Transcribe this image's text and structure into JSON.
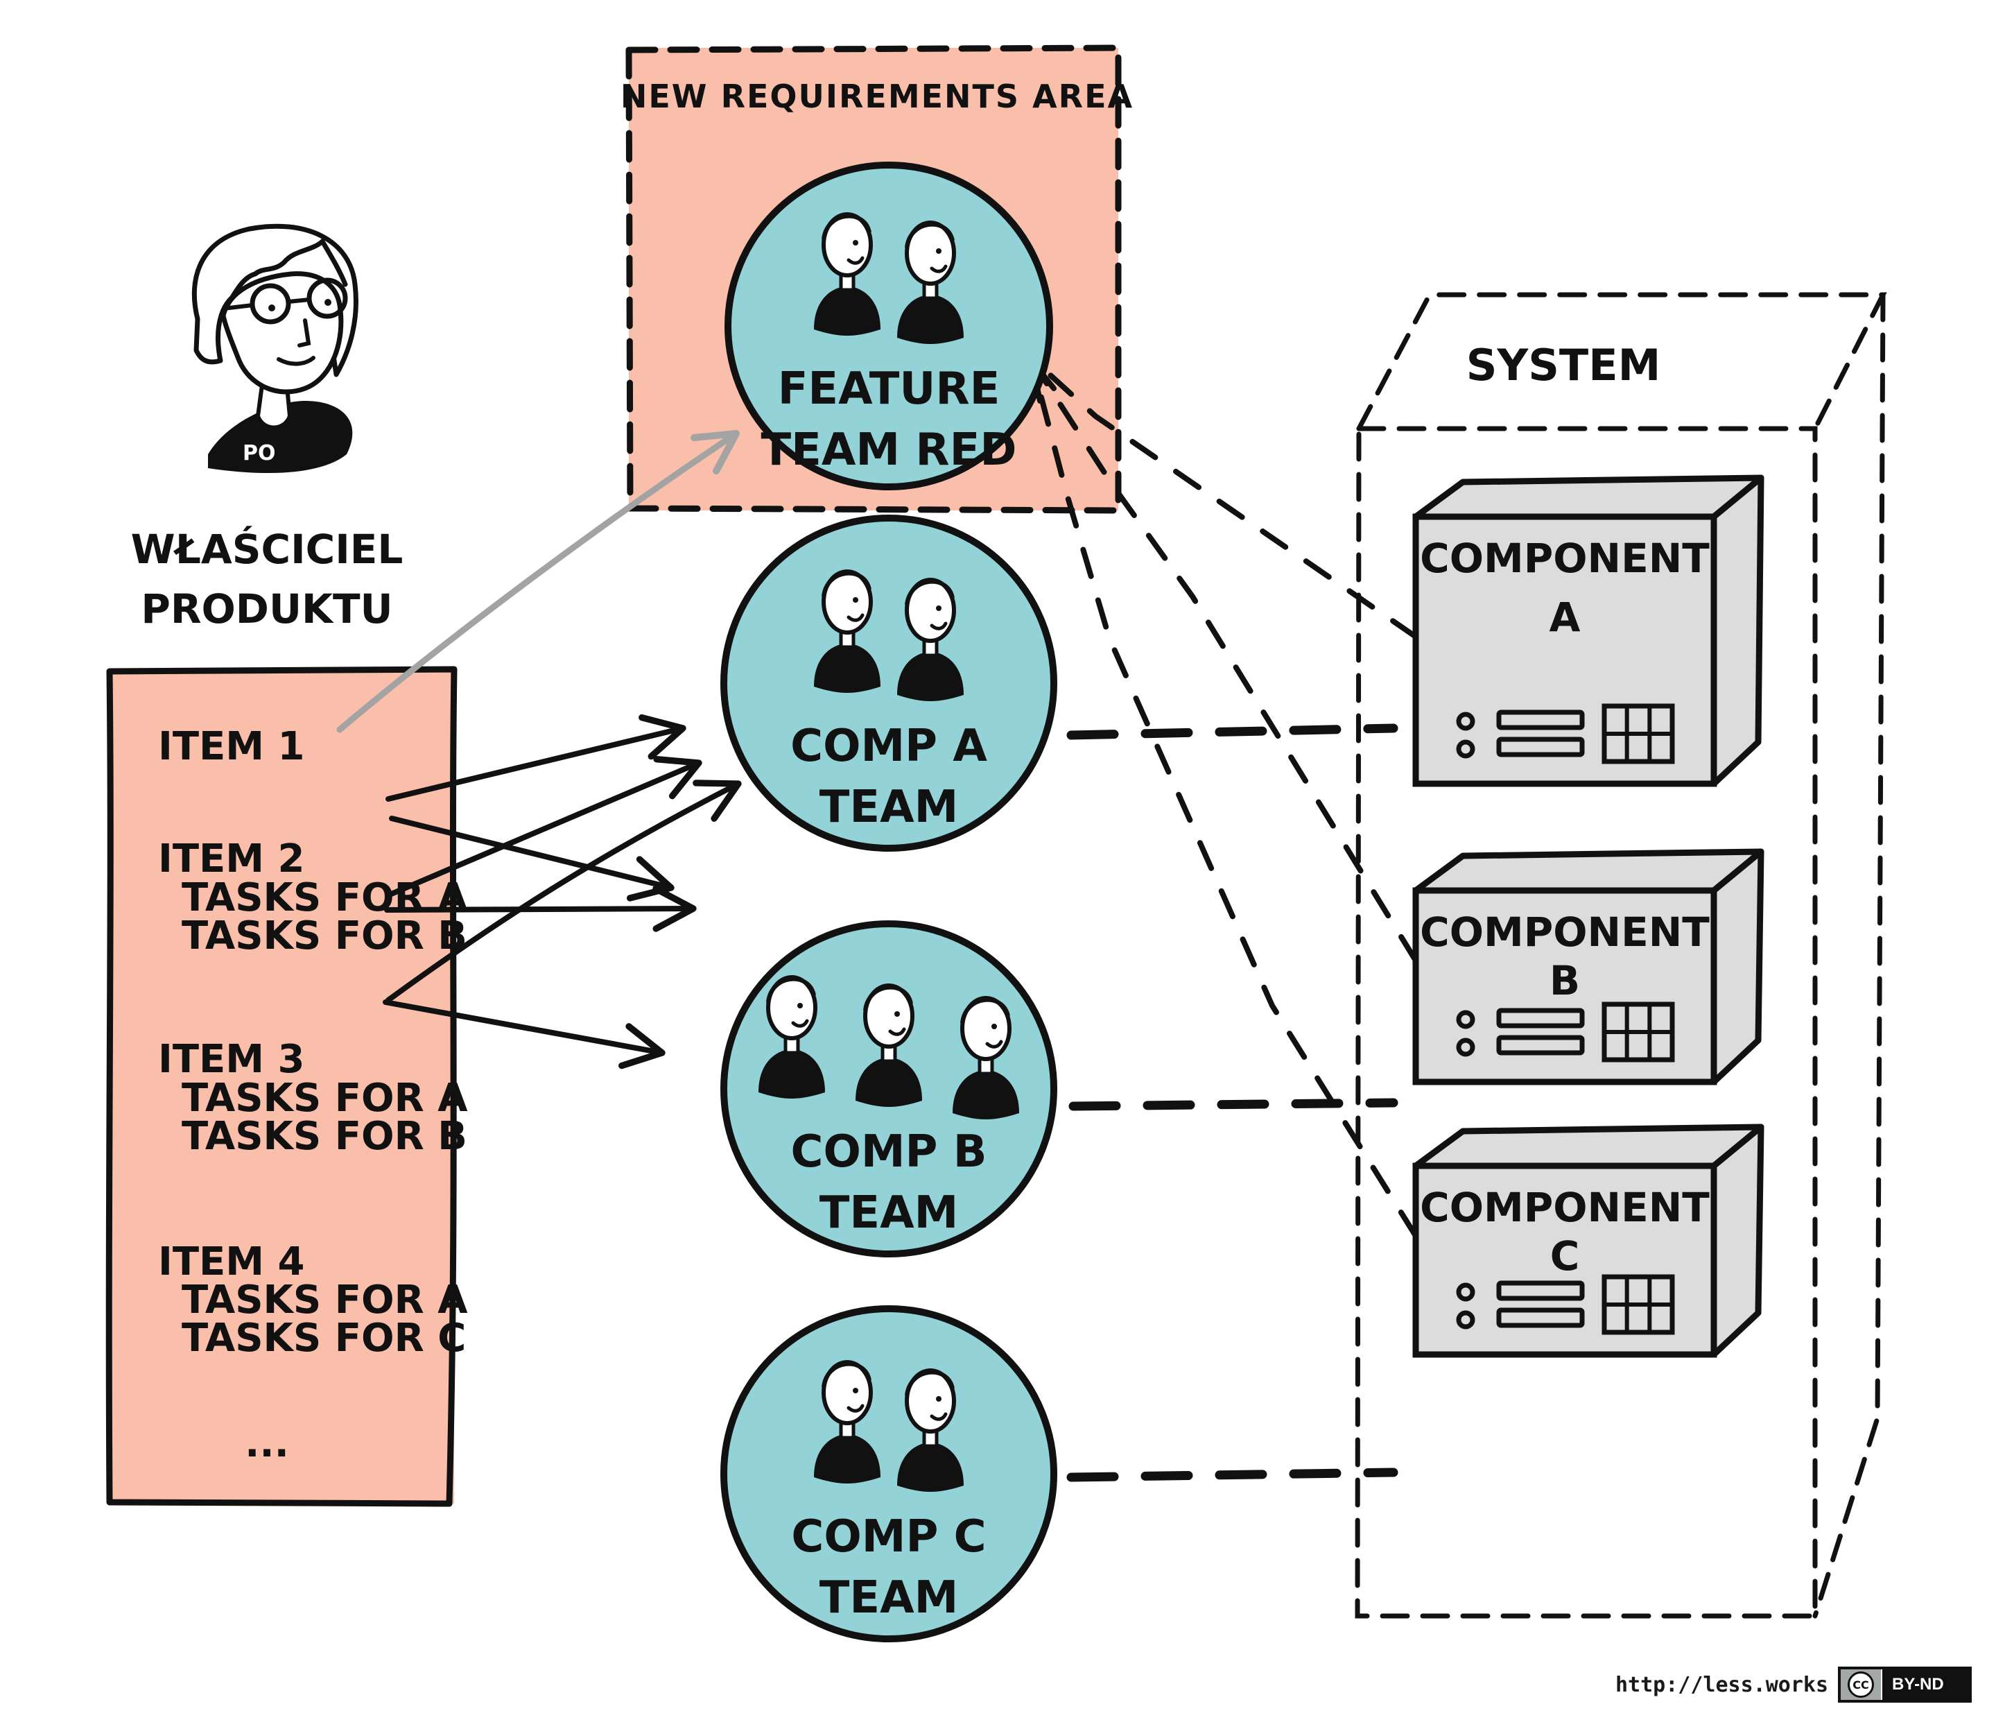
{
  "colors": {
    "backlog_fill": "#f9bfab",
    "team_fill": "#93d3d8",
    "component_fill": "#dcdcdc",
    "ink": "#111111",
    "gray_arrow": "#a3a3a3"
  },
  "product_owner": {
    "badge": "PO",
    "label_line1": "WŁAŚCICIEL",
    "label_line2": "PRODUKTU"
  },
  "backlog": {
    "items": [
      {
        "title": "ITEM 1",
        "tasks": []
      },
      {
        "title": "ITEM 2",
        "tasks": [
          "TASKS FOR A",
          "TASKS FOR B"
        ]
      },
      {
        "title": "ITEM 3",
        "tasks": [
          "TASKS FOR A",
          "TASKS FOR B"
        ]
      },
      {
        "title": "ITEM 4",
        "tasks": [
          "TASKS FOR A",
          "TASKS FOR C"
        ]
      }
    ],
    "ellipsis": "..."
  },
  "requirements_area": {
    "title": "NEW REQUIREMENTS AREA"
  },
  "teams": [
    {
      "id": "feature-red",
      "line1": "FEATURE",
      "line2": "TEAM RED",
      "members": 2
    },
    {
      "id": "comp-a",
      "line1": "COMP A",
      "line2": "TEAM",
      "members": 2
    },
    {
      "id": "comp-b",
      "line1": "COMP B",
      "line2": "TEAM",
      "members": 3
    },
    {
      "id": "comp-c",
      "line1": "COMP C",
      "line2": "TEAM",
      "members": 2
    }
  ],
  "system": {
    "title": "SYSTEM",
    "components": [
      {
        "line1": "COMPONENT",
        "line2": "A"
      },
      {
        "line1": "COMPONENT",
        "line2": "B"
      },
      {
        "line1": "COMPONENT",
        "line2": "C"
      }
    ]
  },
  "connections": {
    "item_arrows": [
      {
        "from": "ITEM 1",
        "to": "FEATURE TEAM RED",
        "style": "gray"
      },
      {
        "from": "ITEM 2 / TASKS FOR A",
        "to": "COMP A TEAM",
        "style": "solid"
      },
      {
        "from": "ITEM 2 / TASKS FOR B",
        "to": "COMP B TEAM",
        "style": "solid"
      },
      {
        "from": "ITEM 3 / TASKS FOR A",
        "to": "COMP A TEAM",
        "style": "solid"
      },
      {
        "from": "ITEM 3 / TASKS FOR B",
        "to": "COMP B TEAM",
        "style": "solid"
      },
      {
        "from": "ITEM 4 / TASKS FOR A",
        "to": "COMP A TEAM",
        "style": "solid"
      },
      {
        "from": "ITEM 4 / TASKS FOR C",
        "to": "COMP C TEAM",
        "style": "solid"
      }
    ],
    "component_links": [
      {
        "from": "COMP A TEAM",
        "to": "COMPONENT A",
        "style": "dashed"
      },
      {
        "from": "COMP B TEAM",
        "to": "COMPONENT B",
        "style": "dashed"
      },
      {
        "from": "COMP C TEAM",
        "to": "COMPONENT C",
        "style": "dashed"
      },
      {
        "from": "COMPONENT A",
        "to": "FEATURE TEAM RED",
        "style": "dashed-arrow"
      },
      {
        "from": "COMPONENT B",
        "to": "FEATURE TEAM RED",
        "style": "dashed-arrow"
      },
      {
        "from": "COMPONENT C",
        "to": "FEATURE TEAM RED",
        "style": "dashed-arrow"
      }
    ]
  },
  "footer": {
    "url": "http://less.works",
    "license_icon": "CC",
    "license": "BY-ND"
  }
}
